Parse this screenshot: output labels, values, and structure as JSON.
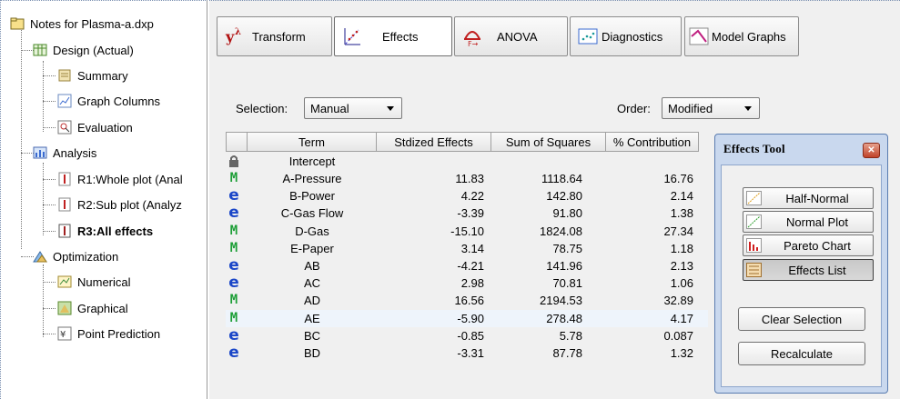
{
  "tree": {
    "root": "Notes for Plasma-a.dxp",
    "design": "Design (Actual)",
    "summary": "Summary",
    "graph_columns": "Graph Columns",
    "evaluation": "Evaluation",
    "analysis": "Analysis",
    "r1": "R1:Whole plot (Anal",
    "r2": "R2:Sub plot (Analyz",
    "r3": "R3:All effects",
    "optimization": "Optimization",
    "numerical": "Numerical",
    "graphical": "Graphical",
    "point_prediction": "Point Prediction"
  },
  "tabs": [
    {
      "label": "Transform",
      "icon": "transform-lambda-icon"
    },
    {
      "label": "Effects",
      "icon": "effects-plot-icon"
    },
    {
      "label": "ANOVA",
      "icon": "anova-icon"
    },
    {
      "label": "Diagnostics",
      "icon": "diagnostics-icon"
    },
    {
      "label": "Model Graphs",
      "icon": "model-graphs-icon"
    }
  ],
  "selection": {
    "label": "Selection:",
    "value": "Manual"
  },
  "order": {
    "label": "Order:",
    "value": "Modified"
  },
  "grid": {
    "headers": [
      "Term",
      "Stdized Effects",
      "Sum of Squares",
      "% Contribution"
    ],
    "intercept": "Intercept",
    "rows": [
      {
        "badge": "M",
        "term": "A-Pressure",
        "effect": "11.83",
        "ss": "1118.64",
        "pct": "16.76"
      },
      {
        "badge": "e",
        "term": "B-Power",
        "effect": "4.22",
        "ss": "142.80",
        "pct": "2.14"
      },
      {
        "badge": "e",
        "term": "C-Gas Flow",
        "effect": "-3.39",
        "ss": "91.80",
        "pct": "1.38"
      },
      {
        "badge": "M",
        "term": "D-Gas",
        "effect": "-15.10",
        "ss": "1824.08",
        "pct": "27.34"
      },
      {
        "badge": "M",
        "term": "E-Paper",
        "effect": "3.14",
        "ss": "78.75",
        "pct": "1.18"
      },
      {
        "badge": "e",
        "term": "AB",
        "effect": "-4.21",
        "ss": "141.96",
        "pct": "2.13"
      },
      {
        "badge": "e",
        "term": "AC",
        "effect": "2.98",
        "ss": "70.81",
        "pct": "1.06"
      },
      {
        "badge": "M",
        "term": "AD",
        "effect": "16.56",
        "ss": "2194.53",
        "pct": "32.89"
      },
      {
        "badge": "M",
        "term": "AE",
        "effect": "-5.90",
        "ss": "278.48",
        "pct": "4.17"
      },
      {
        "badge": "e",
        "term": "BC",
        "effect": "-0.85",
        "ss": "5.78",
        "pct": "0.087"
      },
      {
        "badge": "e",
        "term": "BD",
        "effect": "-3.31",
        "ss": "87.78",
        "pct": "1.32"
      }
    ]
  },
  "tool": {
    "title": "Effects Tool",
    "half_normal": "Half-Normal",
    "normal_plot": "Normal Plot",
    "pareto_chart": "Pareto Chart",
    "effects_list": "Effects List",
    "clear_selection": "Clear Selection",
    "recalculate": "Recalculate"
  },
  "colors": {
    "model_term": "#1c9e36",
    "error_term": "#1a46c8",
    "tool_frame": "#c9d8ee"
  }
}
